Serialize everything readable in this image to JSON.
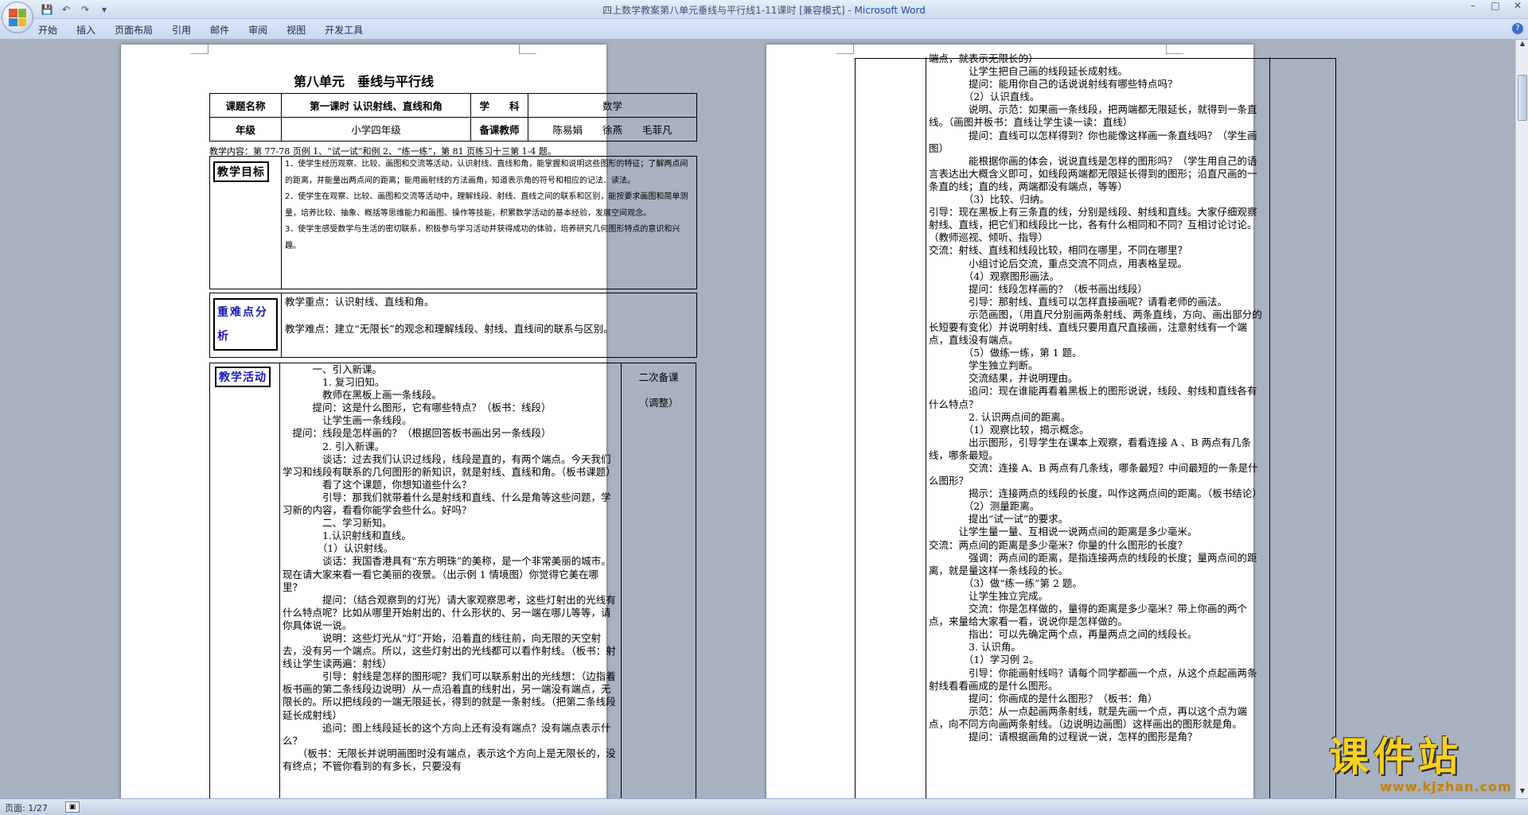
{
  "window": {
    "title_doc": "四上数学教案第八单元垂线与平行线1-11课时 [兼容模式]",
    "title_sep": " - ",
    "title_app": "Microsoft Word",
    "minimize": "–",
    "restore": "□",
    "close": "✕"
  },
  "qat": {
    "save": "💾",
    "undo": "↶",
    "redo": "↷",
    "more": "▾"
  },
  "menu": [
    "开始",
    "插入",
    "页面布局",
    "引用",
    "邮件",
    "审阅",
    "视图",
    "开发工具"
  ],
  "help_icon": "?",
  "status": {
    "page": "页面: 1/27",
    "icon": "▣"
  },
  "doc": {
    "title": "第八单元　垂线与平行线",
    "info": {
      "course_label": "课题名称",
      "course": "第一课时 认识射线、直线和角",
      "subject_label": "学　　科",
      "subject": "数学",
      "grade_label": "年级",
      "grade": "小学四年级",
      "teachers_label": "备课教师",
      "teachers": "陈易娟　　徐燕　　毛菲凡"
    },
    "content_line": "教学内容：第 77-78 页例 1、“试一试”和例 2、“练一练”，第 81 页练习十三第 1-4 题。",
    "goals_label": "教学目标",
    "goals": [
      "1．使学生经历观察、比较、画图和交流等活动，认识射线、直线和角，能掌握和说明这些图形的特征；了解两点间的距离，并能量出两点间的距离；能用画射线的方法画角，知道表示角的符号和相应的记法、读法。",
      "2．使学生在观察、比较、画图和交流等活动中，理解线段、射线、直线之间的联系和区别，能按要求画图和简单测量，培养比较、抽象、概括等思维能力和画图、操作等技能，积累数学活动的基本经验，发展空间观念。",
      "3．使学生感受数学与生活的密切联系，积极参与学习活动并获得成功的体验，培养研究几何图形特点的意识和兴趣。"
    ],
    "focus_label": "重难点分析",
    "focus": [
      "教学重点：认识射线、直线和角。",
      "教学难点：建立“无限长”的观念和理解线段、射线、直线间的联系与区别。"
    ],
    "activity_label": "教学活动",
    "notes": [
      "二次备课",
      "（调整）"
    ],
    "activity": [
      "　　　一、引入新课。",
      "　　　　1. 复习旧知。",
      "　　　　教师在黑板上画一条线段。",
      "　　　提问：这是什么图形，它有哪些特点？（板书：线段）",
      "　　　　让学生画一条线段。",
      "　提问：线段是怎样画的？（根据回答板书画出另一条线段）",
      "　　　　2. 引入新课。",
      "　　　　谈话：过去我们认识过线段，线段是直的，有两个端点。今天我们学习和线段有联系的几何图形的新知识，就是射线、直线和角。（板书课题）",
      "　　　　看了这个课题，你想知道些什么？",
      "　　　　引导：那我们就带着什么是射线和直线、什么是角等这些问题，学习新的内容，看看你能学会些什么。好吗？",
      "　　　　二、学习新知。",
      "　　　　1.认识射线和直线。",
      "　　　　（1）认识射线。",
      "　　　　谈话：我国香港具有“东方明珠”的美称，是一个非常美丽的城市。现在请大家来看一看它美丽的夜景。（出示例 1 情境图）你觉得它美在哪里？",
      "　　　　提问：（结合观察到的灯光）请大家观察思考，这些灯射出的光线有什么特点呢？比如从哪里开始射出的、什么形状的、另一端在哪儿等等，请你具体说一说。",
      "　　　　说明：这些灯光从“灯”开始，沿着直的线往前，向无限的天空射去，没有另一个端点。所以，这些灯射出的光线都可以看作射线。（板书：射线让学生读两遍：射线）",
      "　　　　引导：射线是怎样的图形呢？我们可以联系射出的光线想：（边指着板书画的第二条线段边说明）从一点沿着直的线射出，另一端没有端点，无限长的。所以把线段的一端无限延长，得到的就是一条射线。（把第二条线段延长成射线）",
      "　　　　追问：图上线段延长的这个方向上还有没有端点？没有端点表示什么？",
      "　　（板书：无限长并说明画图时没有端点，表示这个方向上是无限长的，没有终点；不管你看到的有多长，只要没有"
    ],
    "right": [
      "端点，就表示无限长的）",
      "　　　　让学生把自己画的线段延长成射线。",
      "　　　　提问：能用你自己的话说说射线有哪些特点吗？",
      "　　　　（2）认识直线。",
      "　　　　说明、示范：如果画一条线段，把两端都无限延长，就得到一条直线。（画图并板书：直线让学生读一读：直线）",
      "　　　　提问：直线可以怎样得到？你也能像这样画一条直线吗？（学生画图）",
      "　　　　能根据你画的体会，说说直线是怎样的图形吗？（学生用自己的语言表达出大概含义即可，如线段两端都无限延长得到的图形；沿直尺画的一条直的线；直的线，两端都没有端点，等等）",
      "　　　　（3）比较、归纳。",
      "引导：现在黑板上有三条直的线，分别是线段、射线和直线。大家仔细观察射线、直线，把它们和线段比一比，各有什么相同和不同？互相讨论讨论。（教师巡视、倾听、指导）",
      "交流：射线、直线和线段比较，相同在哪里，不同在哪里？",
      "　　　　小组讨论后交流，重点交流不同点，用表格呈现。",
      "　　　　（4）观察图形画法。",
      "　　　　提问：线段怎样画的？（板书画出线段）",
      "　　　　引导：那射线、直线可以怎样直接画呢？请看老师的画法。",
      "　　　　示范画图，（用直尺分别画两条射线、两条直线，方向、画出部分的长短要有变化）并说明射线、直线只要用直尺直接画，注意射线有一个端点，直线没有端点。",
      "　　　　（5）做练一练，第 1 题。",
      "　　　　学生独立判断。",
      "　　　　交流结果，并说明理由。",
      "　　　　追问：现在谁能再看着黑板上的图形说说，线段、射线和直线各有什么特点？",
      "　　　　2. 认识两点间的距离。",
      "　　　　（1）观察比较，揭示概念。",
      "　　　　出示图形，引导学生在课本上观察，看看连接 A 、B 两点有几条线，哪条最短。",
      "　　　　交流：连接 A、B 两点有几条线，哪条最短？中间最短的一条是什么图形？",
      "　　　　揭示：连接两点的线段的长度，叫作这两点间的距离。（板书结论）",
      "　　　　（2）测量距离。",
      "　　　　提出“试一试”的要求。",
      "　　　让学生量一量、互相说一说两点间的距离是多少毫米。",
      "交流：两点间的距离是多少毫米？你量的什么图形的长度？",
      "　　　　强调：两点间的距离，是指连接两点的线段的长度；量两点间的距离，就是量这样一条线段的长。",
      "　　　　（3）做“练一练”第 2 题。",
      "　　　　让学生独立完成。",
      "　　　　交流：你是怎样做的，量得的距离是多少毫米？带上你画的两个点，来量给大家看一看，说说你是怎样做的。",
      "　　　　指出：可以先确定两个点，再量两点之间的线段长。",
      "　　　　3. 认识角。",
      "　　　　（1）学习例 2。",
      "　　　　引导：你能画射线吗？请每个同学都画一个点，从这个点起画两条射线看看画成的是什么图形。",
      "　　　　提问：你画成的是什么图形？（板书：角）",
      "　　　　示范：从一点起画两条射线，就是先画一个点，再以这个点为端点，向不同方向画两条射线。（边说明边画图）这样画出的图形就是角。",
      "　　　　提问：请根据画角的过程说一说，怎样的图形是角？"
    ]
  },
  "watermark": {
    "brand": "课件站",
    "url": "www.kjzhan.com"
  }
}
